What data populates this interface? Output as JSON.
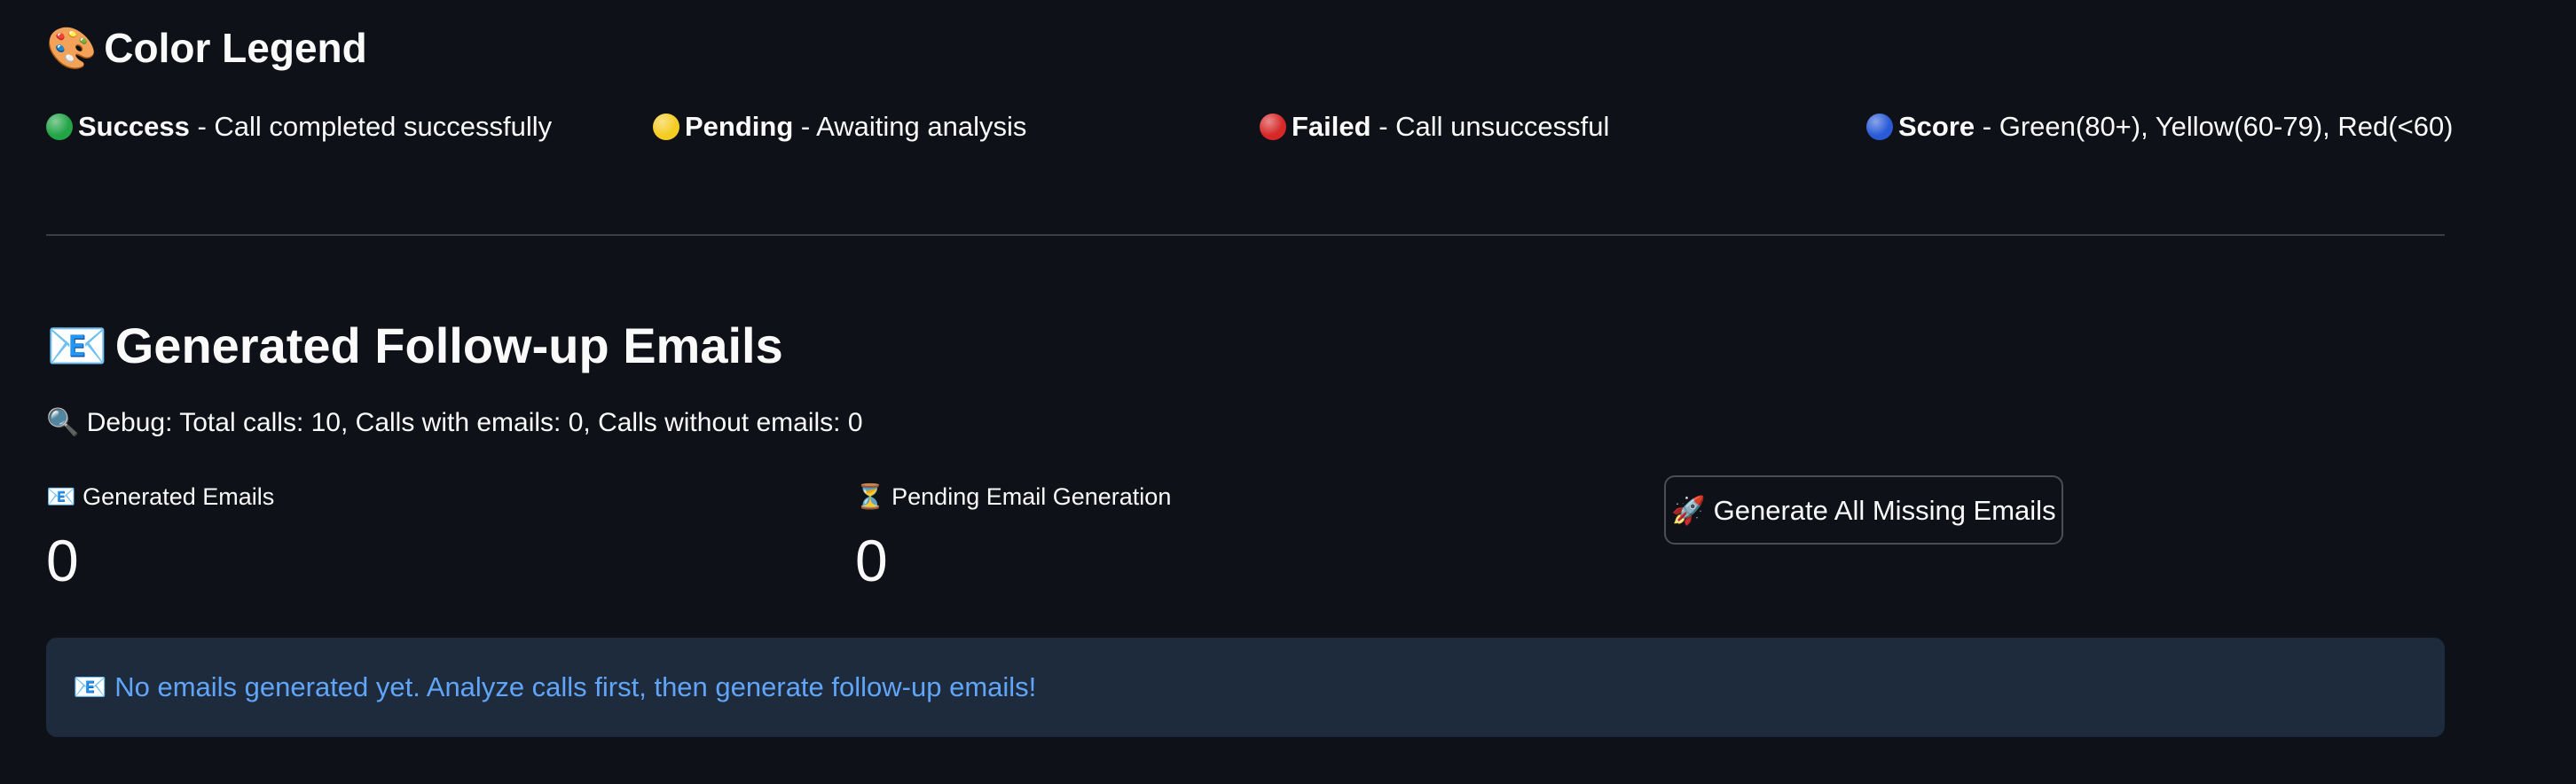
{
  "legend": {
    "title_emoji": "🎨",
    "title": "Color Legend",
    "items": [
      {
        "dot_color": "#22a447",
        "label": "Success",
        "description": " - Call completed successfully"
      },
      {
        "dot_color": "#f5cc23",
        "label": "Pending",
        "description": " - Awaiting analysis"
      },
      {
        "dot_color": "#d62828",
        "label": "Failed",
        "description": " - Call unsuccessful"
      },
      {
        "dot_color": "#2a5bd7",
        "label": "Score",
        "description": " - Green(80+), Yellow(60-79), Red(<60)"
      }
    ]
  },
  "emails": {
    "title_emoji": "📧",
    "title": "Generated Follow-up Emails",
    "debug_emoji": "🔍",
    "debug_text": "Debug: Total calls: 10, Calls with emails: 0, Calls without emails: 0",
    "metrics": [
      {
        "emoji": "📧",
        "label": "Generated Emails",
        "value": "0"
      },
      {
        "emoji": "⏳",
        "label": "Pending Email Generation",
        "value": "0"
      }
    ],
    "generate_button_emoji": "🚀",
    "generate_button_label": "Generate All Missing Emails",
    "info_emoji": "📧",
    "info_text": "No emails generated yet. Analyze calls first, then generate follow-up emails!"
  },
  "colors": {
    "background": "#0e1117",
    "text": "#fafafa",
    "info_background": "#1e2b3d",
    "info_text": "#60a5fa"
  }
}
